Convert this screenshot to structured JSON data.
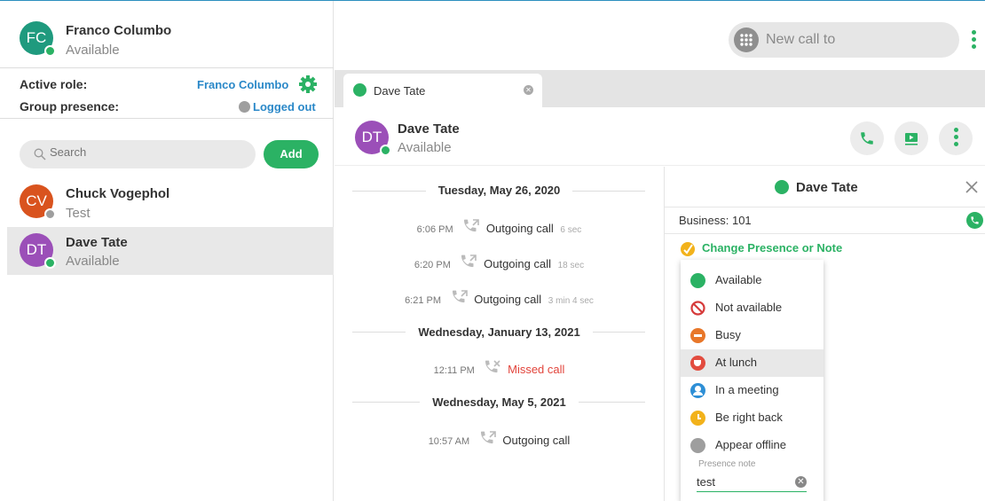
{
  "user": {
    "initials": "FC",
    "name": "Franco Columbo",
    "status": "Available"
  },
  "roles": {
    "active_role_label": "Active role:",
    "active_role_value": "Franco Columbo",
    "group_presence_label": "Group presence:",
    "group_presence_value": "Logged out"
  },
  "search": {
    "placeholder": "Search"
  },
  "add_label": "Add",
  "contacts": [
    {
      "initials": "CV",
      "name": "Chuck Vogephol",
      "status": "Test",
      "color": "#d9531e",
      "presence_color": "#9e9e9e"
    },
    {
      "initials": "DT",
      "name": "Dave Tate",
      "status": "Available",
      "color": "#9b4fb8",
      "presence_color": "#2bb264"
    }
  ],
  "new_call": {
    "placeholder": "New call to"
  },
  "tab": {
    "label": "Dave Tate"
  },
  "conversation": {
    "initials": "DT",
    "name": "Dave Tate",
    "status": "Available"
  },
  "history": {
    "days": [
      {
        "label": "Tuesday, May 26, 2020"
      },
      {
        "label": "Wednesday, January 13, 2021"
      },
      {
        "label": "Wednesday, May 5, 2021"
      }
    ],
    "calls": [
      {
        "time": "6:06 PM",
        "type": "Outgoing call",
        "duration": "6 sec"
      },
      {
        "time": "6:20 PM",
        "type": "Outgoing call",
        "duration": "18 sec"
      },
      {
        "time": "6:21 PM",
        "type": "Outgoing call",
        "duration": "3 min 4 sec"
      },
      {
        "time": "12:11 PM",
        "type": "Missed call",
        "duration": ""
      },
      {
        "time": "10:57 AM",
        "type": "Outgoing call",
        "duration": ""
      }
    ]
  },
  "details": {
    "name": "Dave Tate",
    "business": "Business: 101",
    "change_presence": "Change Presence or Note"
  },
  "presence_menu": {
    "items": [
      {
        "label": "Available",
        "color": "#2bb264",
        "icon": "available-icon"
      },
      {
        "label": "Not available",
        "color": "#d63b3b",
        "icon": "not-available-icon"
      },
      {
        "label": "Busy",
        "color": "#e8772a",
        "icon": "busy-icon"
      },
      {
        "label": "At lunch",
        "color": "#e24c3f",
        "icon": "lunch-icon"
      },
      {
        "label": "In a meeting",
        "color": "#2e8fd6",
        "icon": "meeting-icon"
      },
      {
        "label": "Be right back",
        "color": "#f2b21b",
        "icon": "clock-icon"
      },
      {
        "label": "Appear offline",
        "color": "#9e9e9e",
        "icon": "offline-icon"
      }
    ],
    "note_label": "Presence note",
    "note_value": "test"
  },
  "colors": {
    "accent": "#2bb264",
    "link": "#2a88c8",
    "missed": "#e2453c"
  }
}
